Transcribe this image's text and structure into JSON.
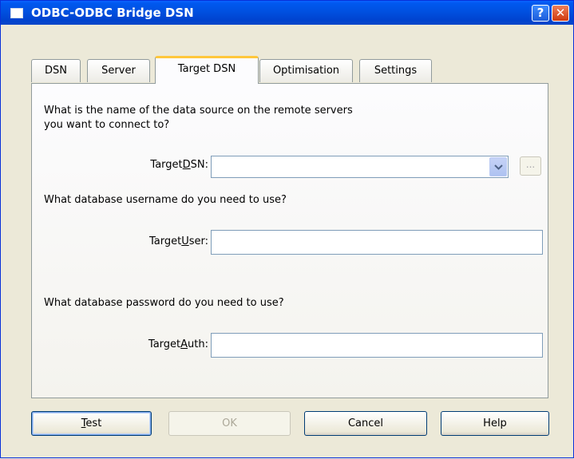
{
  "window": {
    "title": "ODBC-ODBC Bridge DSN",
    "help_glyph": "?",
    "close_glyph": "✕"
  },
  "tabs": [
    {
      "label": "DSN"
    },
    {
      "label": "Server"
    },
    {
      "label": "Target DSN",
      "active": true
    },
    {
      "label": "Optimisation"
    },
    {
      "label": "Settings"
    }
  ],
  "panel": {
    "q1_line1": "What is the name of the data source on the remote servers",
    "q1_line2": "you want to connect to?",
    "dsn_label_pre": "Target",
    "dsn_label_key": "D",
    "dsn_label_post": "SN:",
    "dsn_value": "",
    "browse_label": "...",
    "q2": "What database username do you need to use?",
    "user_label_pre": "Target",
    "user_label_key": "U",
    "user_label_post": "ser:",
    "user_value": "",
    "q3": "What database password do you need to use?",
    "auth_label_pre": "Target",
    "auth_label_key": "A",
    "auth_label_post": "uth:",
    "auth_value": ""
  },
  "buttons": {
    "test_key": "T",
    "test_rest": "est",
    "ok": "OK",
    "cancel": "Cancel",
    "help": "Help"
  },
  "colors": {
    "titlebar": "#0054e3",
    "face": "#ece9d8",
    "active_tab_accent": "#ffc73c"
  }
}
